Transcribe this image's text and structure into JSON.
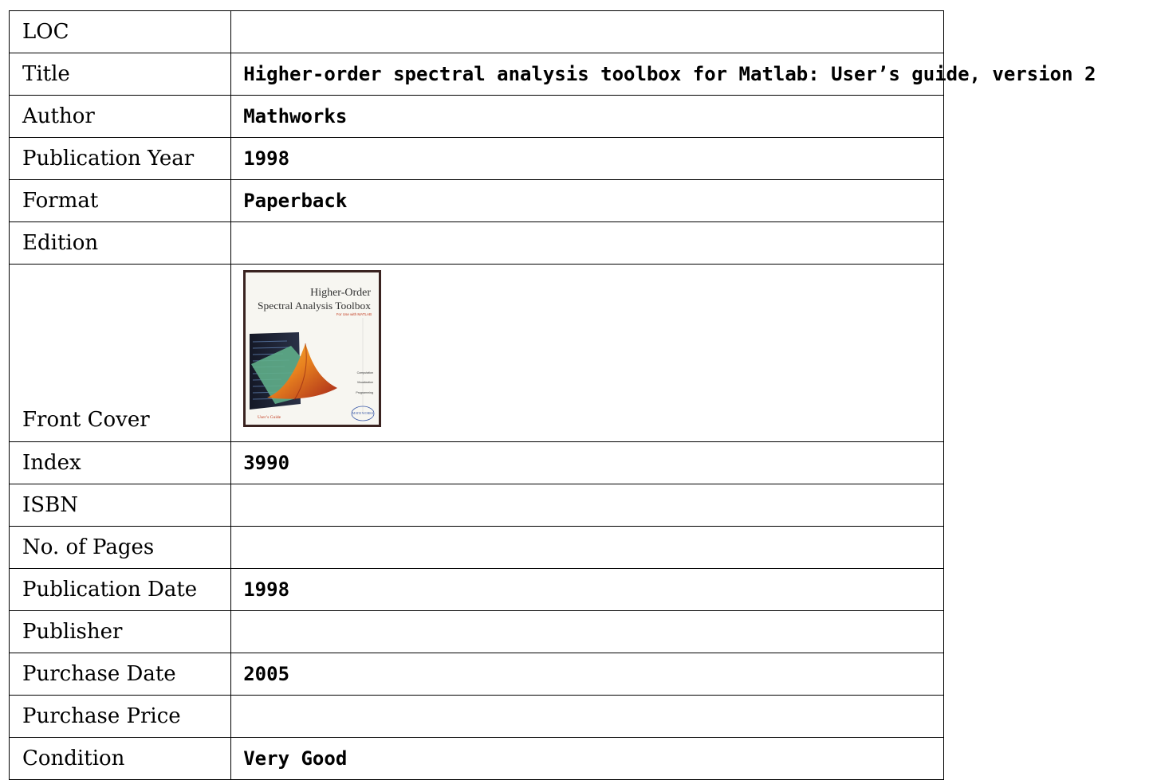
{
  "record": {
    "rows": [
      {
        "label": "LOC",
        "value": ""
      },
      {
        "label": "Title",
        "value": "Higher-order spectral analysis toolbox for Matlab: User’s guide, version 2"
      },
      {
        "label": "Author",
        "value": "Mathworks"
      },
      {
        "label": "Publication Year",
        "value": "1998"
      },
      {
        "label": "Format",
        "value": "Paperback"
      },
      {
        "label": "Edition",
        "value": ""
      },
      {
        "label": "Front Cover",
        "value": ""
      },
      {
        "label": "Index",
        "value": "3990"
      },
      {
        "label": "ISBN",
        "value": ""
      },
      {
        "label": "No. of Pages",
        "value": ""
      },
      {
        "label": "Publication Date",
        "value": "1998"
      },
      {
        "label": "Publisher",
        "value": ""
      },
      {
        "label": "Purchase Date",
        "value": "2005"
      },
      {
        "label": "Purchase Price",
        "value": ""
      },
      {
        "label": "Condition",
        "value": "Very Good"
      }
    ]
  },
  "cover": {
    "title_line1": "Higher-Order",
    "title_line2": "Spectral Analysis Toolbox",
    "subtitle": "For Use with MATLAB",
    "side_labels": [
      "Computation",
      "Visualization",
      "Programming"
    ],
    "footer": "User’s Guide",
    "logo_text": "MATH WORKS",
    "colors": {
      "background": "#f7f6f1",
      "frame": "#3a2320",
      "dark_panel": "#1b2030",
      "accent_red": "#c23a1e",
      "accent_orange": "#e8821f",
      "accent_green": "#5fae8a"
    }
  }
}
